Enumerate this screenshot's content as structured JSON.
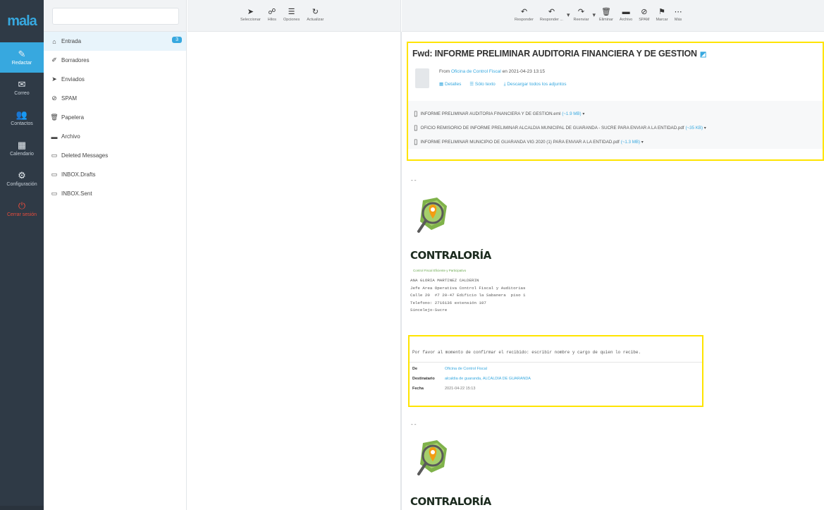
{
  "nav": {
    "logo": "mala",
    "items": [
      {
        "icon": "compose-icon",
        "glyph": "✎",
        "label": "Redactar"
      },
      {
        "icon": "mail-icon",
        "glyph": "✉",
        "label": "Correo"
      },
      {
        "icon": "contacts-icon",
        "glyph": "👥",
        "label": "Contactos"
      },
      {
        "icon": "calendar-icon",
        "glyph": "▦",
        "label": "Calendario"
      },
      {
        "icon": "gear-icon",
        "glyph": "⚙",
        "label": "Configuración"
      },
      {
        "icon": "power-icon",
        "glyph": "⏻",
        "label": "Cerrar sesión"
      }
    ]
  },
  "search": {
    "value": "",
    "placeholder": ""
  },
  "folders": [
    {
      "icon": "inbox-icon",
      "glyph": "⌂",
      "label": "Entrada",
      "badge": "3"
    },
    {
      "icon": "pencil-icon",
      "glyph": "✐",
      "label": "Borradores"
    },
    {
      "icon": "send-icon",
      "glyph": "➤",
      "label": "Enviados"
    },
    {
      "icon": "spam-icon",
      "glyph": "⊘",
      "label": "SPAM"
    },
    {
      "icon": "trash-icon",
      "glyph": "🗑",
      "label": "Papelera"
    },
    {
      "icon": "archive-icon",
      "glyph": "▬",
      "label": "Archivo"
    },
    {
      "icon": "folder-icon",
      "glyph": "▭",
      "label": "Deleted Messages"
    },
    {
      "icon": "folder-icon",
      "glyph": "▭",
      "label": "INBOX.Drafts"
    },
    {
      "icon": "folder-icon",
      "glyph": "▭",
      "label": "INBOX.Sent"
    }
  ],
  "list_toolbar": [
    {
      "icon": "cursor-icon",
      "glyph": "➤",
      "label": "Seleccionar"
    },
    {
      "icon": "threads-icon",
      "glyph": "☍",
      "label": "Hilos"
    },
    {
      "icon": "options-icon",
      "glyph": "☰",
      "label": "Opciones"
    },
    {
      "icon": "refresh-icon",
      "glyph": "↻",
      "label": "Actualizar"
    }
  ],
  "preview_toolbar": [
    {
      "icon": "reply-icon",
      "glyph": "↶",
      "label": "Responder"
    },
    {
      "icon": "reply-all-icon",
      "glyph": "↶",
      "label": "Responder ..."
    },
    {
      "icon": "forward-icon",
      "glyph": "↷",
      "label": "Reenviar"
    },
    {
      "icon": "trash-icon",
      "glyph": "🗑",
      "label": "Eliminar"
    },
    {
      "icon": "archive-icon",
      "glyph": "▬",
      "label": "Archivo"
    },
    {
      "icon": "spam-icon",
      "glyph": "⊘",
      "label": "SPAM"
    },
    {
      "icon": "mark-icon",
      "glyph": "⚑",
      "label": "Marcar"
    },
    {
      "icon": "more-icon",
      "glyph": "⋯",
      "label": "Más"
    }
  ],
  "message": {
    "subject": "Fwd: INFORME PRELIMINAR AUDITORIA FINANCIERA Y DE GESTION",
    "from_prefix": "From",
    "from_name": "Oficina de Control Fiscal",
    "date": "en 2021-04-23 13:15",
    "actions": [
      "Detalles",
      "Sólo texto",
      "Descargar todos los adjuntos"
    ],
    "attachments": [
      {
        "name": "INFORME PRELIMINAR AUDITORIA FINANCIERA Y DE GESTION.eml",
        "size": "(~1.9 MB)"
      },
      {
        "name": "OFICIO REMISORIO DE INFORME PRELIMINAR ALCALDIA MUNICIPAL DE GUARANDA - SUCRE PARA ENVIAR A LA ENTIDAD.pdf",
        "size": "(~35 KB)"
      },
      {
        "name": "INFORME PRELIMINAR MUNICIPIO DE GUARANDA VIG 2020 (1) PARA ENVIAR A LA ENTIDAD.pdf",
        "size": "(~1.3 MB)"
      }
    ]
  },
  "body": {
    "separator": "--",
    "logo_word": "CONTRALORÍA",
    "logo_tagline": "Control Fiscal Eficiente y Participativo",
    "signature": [
      "ANA GLORIA MARTINEZ CALDERIN",
      "Jefe Area Operativa Control Fiscal y Auditorias",
      "Calle 20  #7 20-47 Edificio la Sabanera  piso 1",
      "Telefono: 2716136 extensión 107",
      "Sincelejo-Sucre"
    ],
    "confirm_text": "Por favor al momento de confirmar el recibido: escribir nombre y cargo de quien lo recibe.",
    "forward": {
      "de_label": "De",
      "de_value": "Oficina de Control Fiscal",
      "dest_label": "Destinatario",
      "dest_value": "alcaldia de guaranda, ALCALDIA DE GUARANDA",
      "fecha_label": "Fecha",
      "fecha_value": "2021-04-22 15:13"
    },
    "separator2": "--"
  },
  "colors": {
    "accent": "#37a8df",
    "highlight": "#ffe400",
    "nav": "#2f3a46"
  }
}
